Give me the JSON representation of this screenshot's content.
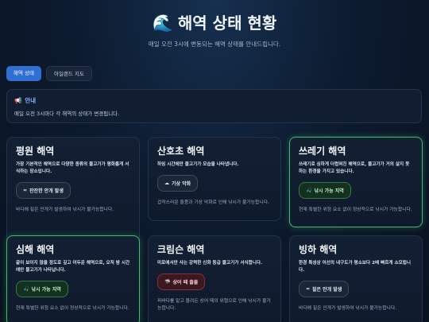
{
  "header": {
    "icon": "wave-icon",
    "title": "해역 상태 현황",
    "subtitle": "매일 오전 3시에 변동되는 해역 상태를 안내드립니다."
  },
  "tabs": [
    {
      "label": "해역 상태",
      "active": true
    },
    {
      "label": "아일랜드 지도",
      "active": false
    }
  ],
  "notice": {
    "icon": "megaphone-icon",
    "heading": "안내",
    "body": "매일 오전 3시마다 각 해역의 상태가 변경됩니다."
  },
  "cards": [
    {
      "title": "평원 해역",
      "desc": "가장 기본적인 해역으로 다양한 종류의 물고기가 평화롭게 서식하는 장소입니다.",
      "badge": "잔잔한 안개 발생",
      "badge_icon": "fog-icon",
      "note": "바다에 짙은 안개가 발생하여 낚시가 불가능합니다.",
      "status": "neutral"
    },
    {
      "title": "산호초 해역",
      "desc": "하임 시간에만 물고기가 모습을 나타냅니다.",
      "badge": "기상 악화",
      "badge_icon": "cloud-icon",
      "note": "갑작스러운 돌풍과 기상 악화로 인해 낚시가 불가능합니다.",
      "status": "neutral"
    },
    {
      "title": "쓰레기 해역",
      "desc": "쓰레기로 심하게 더럽혀진 해역으로, 물고기가 거의 살지 못하는 환경을 가지고 있습니다.",
      "badge": "낚시 가능 지역",
      "badge_icon": "fishing-icon",
      "note": "현재 특별한 위험 요소 없이 정상적으로 낚시가 가능합니다.",
      "status": "ok"
    },
    {
      "title": "심해 해역",
      "desc": "끝이 보이지 않을 정도로 깊고 어두운 해역으로, 오직 밤 시간에만 물고기가 나타납니다.",
      "badge": "낚시 가능 지역",
      "badge_icon": "fishing-icon",
      "note": "현재 특별한 위험 요소 없이 정상적으로 낚시가 가능합니다.",
      "status": "ok"
    },
    {
      "title": "크림슨 해역",
      "desc": "미로에서만 사는 강력한 신화 등급 물고기가 서식합니다.",
      "badge": "상어 떼 출몰",
      "badge_icon": "shark-icon",
      "note": "피바다를 맡고 몰려든 상어 떼의 위협으로 인해 낚시가 불가능합니다.",
      "status": "danger"
    },
    {
      "title": "빙하 해역",
      "desc": "한경 특성상 어선의 내구도가 평소보다 2배 빠르게 소모됩니다.",
      "badge": "짙은 안개 발생",
      "badge_icon": "fog-icon",
      "note": "바다에 짙은 안개가 발생하여 낚시가 불가능합니다.",
      "status": "neutral"
    }
  ]
}
